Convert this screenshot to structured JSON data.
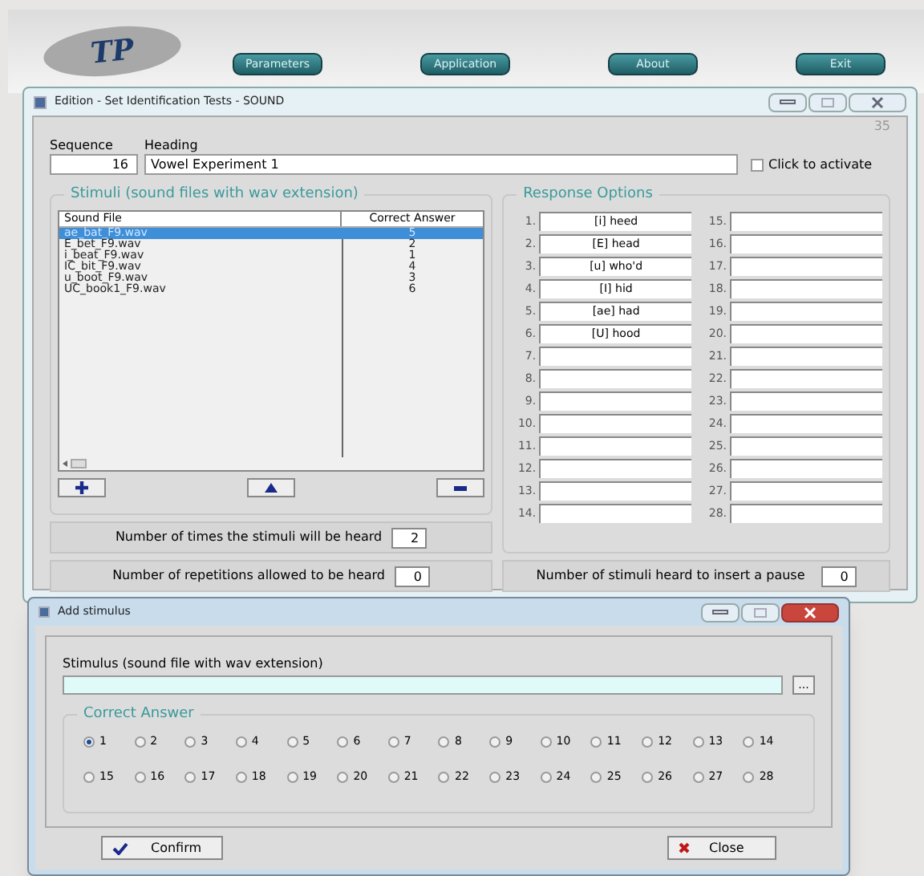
{
  "app": {
    "logo": "TP",
    "menu": [
      {
        "label": "Parameters"
      },
      {
        "label": "Application"
      },
      {
        "label": "About"
      },
      {
        "label": "Exit"
      }
    ]
  },
  "window": {
    "title": "Edition - Set Identification Tests - SOUND",
    "counter": "35",
    "sequence": {
      "label": "Sequence",
      "value": "16"
    },
    "heading": {
      "label": "Heading",
      "value": "Vowel Experiment 1"
    },
    "activate": {
      "label": "Click to activate",
      "checked": false
    },
    "stimuli": {
      "title": "Stimuli (sound files with wav extension)",
      "columns": [
        "Sound File",
        "Correct Answer"
      ],
      "rows": [
        {
          "file": "ae_bat_F9.wav",
          "answer": "5",
          "selected": true
        },
        {
          "file": "E_bet_F9.wav",
          "answer": "2",
          "selected": false
        },
        {
          "file": "i_beat_F9.wav",
          "answer": "1",
          "selected": false
        },
        {
          "file": "IC_bit_F9.wav",
          "answer": "4",
          "selected": false
        },
        {
          "file": "u_boot_F9.wav",
          "answer": "3",
          "selected": false
        },
        {
          "file": "UC_book1_F9.wav",
          "answer": "6",
          "selected": false
        }
      ]
    },
    "times_heard": {
      "label": "Number of times the stimuli will be heard",
      "value": "2"
    },
    "repetitions": {
      "label": "Number of repetitions allowed to be heard",
      "value": "0"
    },
    "responses": {
      "title": "Response Options",
      "options": [
        {
          "number": "1.",
          "value": "[i] heed"
        },
        {
          "number": "2.",
          "value": "[E] head"
        },
        {
          "number": "3.",
          "value": "[u] who'd"
        },
        {
          "number": "4.",
          "value": "[I] hid"
        },
        {
          "number": "5.",
          "value": "[ae] had"
        },
        {
          "number": "6.",
          "value": "[U] hood"
        },
        {
          "number": "7."
        },
        {
          "number": "8."
        },
        {
          "number": "9."
        },
        {
          "number": "10."
        },
        {
          "number": "11."
        },
        {
          "number": "12."
        },
        {
          "number": "13."
        },
        {
          "number": "14."
        },
        {
          "number": "15."
        },
        {
          "number": "16."
        },
        {
          "number": "17."
        },
        {
          "number": "18."
        },
        {
          "number": "19."
        },
        {
          "number": "20."
        },
        {
          "number": "21."
        },
        {
          "number": "22."
        },
        {
          "number": "23."
        },
        {
          "number": "24."
        },
        {
          "number": "25."
        },
        {
          "number": "26."
        },
        {
          "number": "27."
        },
        {
          "number": "28."
        }
      ]
    },
    "pause": {
      "label": "Number of stimuli heard to insert a pause",
      "value": "0"
    }
  },
  "dialog": {
    "title": "Add stimulus",
    "stimulus_label": "Stimulus (sound file with wav extension)",
    "browse": "...",
    "answer_title": "Correct Answer",
    "answers": [
      {
        "label": "1",
        "selected": true
      },
      {
        "label": "2",
        "selected": false
      },
      {
        "label": "3",
        "selected": false
      },
      {
        "label": "4",
        "selected": false
      },
      {
        "label": "5",
        "selected": false
      },
      {
        "label": "6",
        "selected": false
      },
      {
        "label": "7",
        "selected": false
      },
      {
        "label": "8",
        "selected": false
      },
      {
        "label": "9",
        "selected": false
      },
      {
        "label": "10",
        "selected": false
      },
      {
        "label": "11",
        "selected": false
      },
      {
        "label": "12",
        "selected": false
      },
      {
        "label": "13",
        "selected": false
      },
      {
        "label": "14",
        "selected": false
      },
      {
        "label": "15",
        "selected": false
      },
      {
        "label": "16",
        "selected": false
      },
      {
        "label": "17",
        "selected": false
      },
      {
        "label": "18",
        "selected": false
      },
      {
        "label": "19",
        "selected": false
      },
      {
        "label": "20",
        "selected": false
      },
      {
        "label": "21",
        "selected": false
      },
      {
        "label": "22",
        "selected": false
      },
      {
        "label": "23",
        "selected": false
      },
      {
        "label": "24",
        "selected": false
      },
      {
        "label": "25",
        "selected": false
      },
      {
        "label": "26",
        "selected": false
      },
      {
        "label": "27",
        "selected": false
      },
      {
        "label": "28",
        "selected": false
      }
    ],
    "confirm": "Confirm",
    "close": "Close"
  }
}
